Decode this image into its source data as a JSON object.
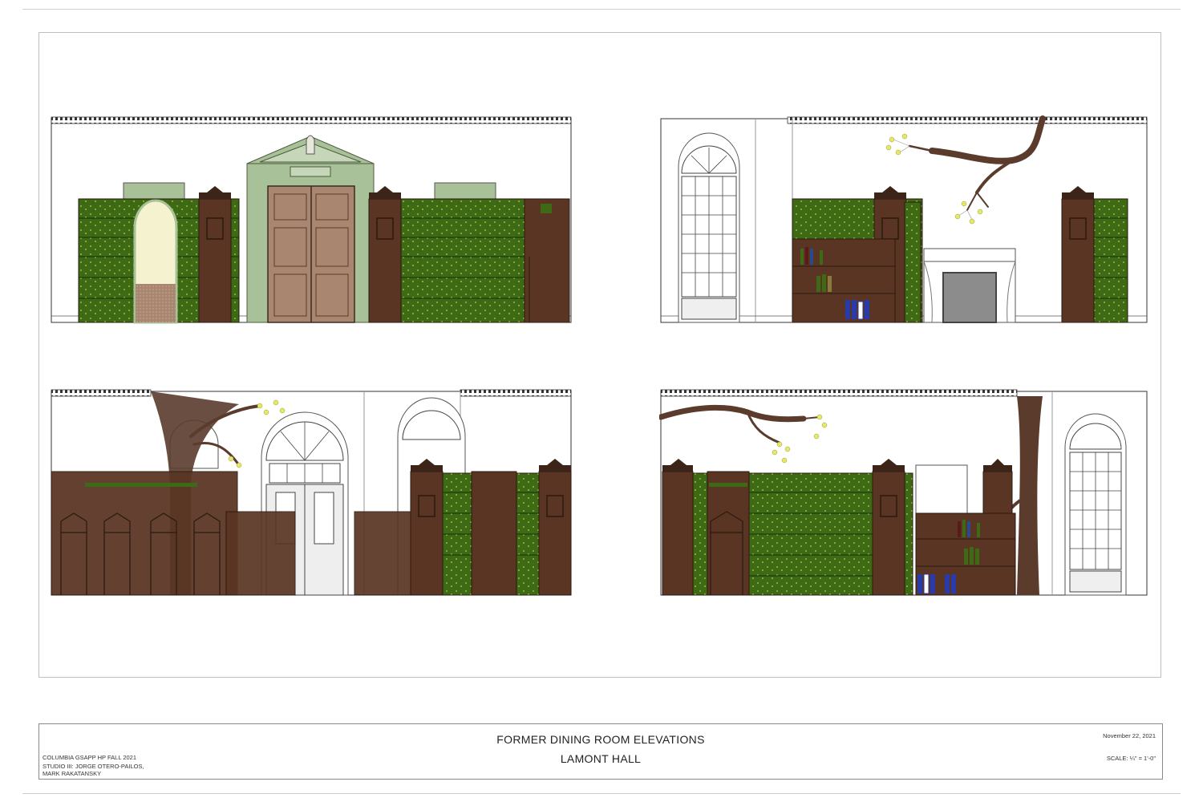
{
  "title_block": {
    "title": "FORMER DINING ROOM ELEVATIONS",
    "subtitle": "LAMONT HALL",
    "school": "COLUMBIA GSAPP HP FALL 2021",
    "studio": "STUDIO III: JORGE OTERO-PAILOS,",
    "studio_2": "MARK RAKATANSKY",
    "date": "November 22, 2021",
    "scale": "SCALE: ¼\" = 1'-0\""
  },
  "colors": {
    "wood": "#5a3523",
    "wood_dark": "#3d2418",
    "green": "#3e6a16",
    "green_light": "#6fa22a",
    "sage": "#a9c198",
    "door_panel": "#a88670",
    "cream": "#f5f2cf",
    "grey": "#8c8c8c",
    "bark": "#5a3b2c",
    "blossom": "#e4ea64"
  }
}
